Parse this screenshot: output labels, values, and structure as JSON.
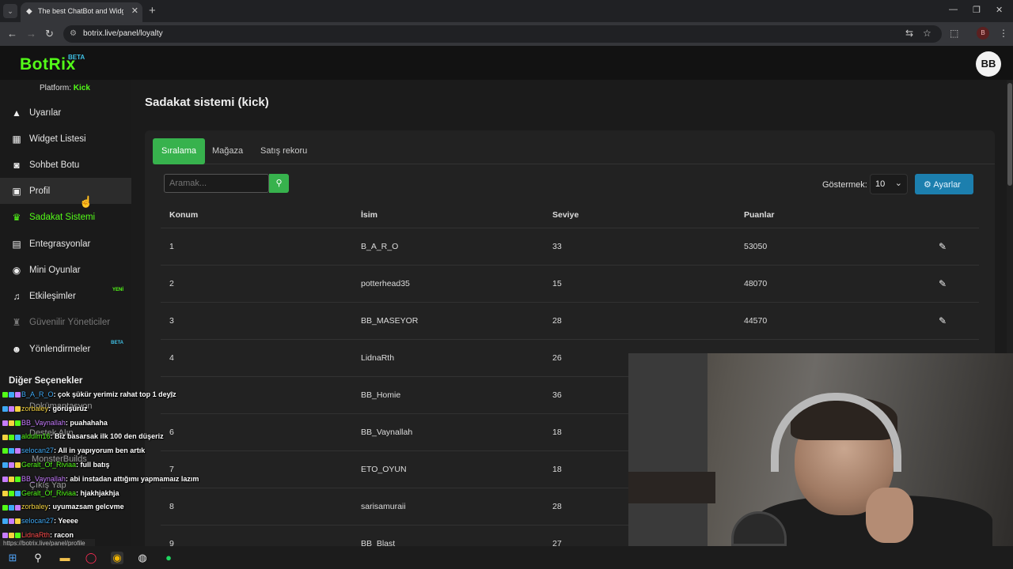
{
  "browser": {
    "tab_title": "The best ChatBot and Widgets",
    "url": "botrix.live/panel/loyalty",
    "profile_initial": "B",
    "status_url": "https://botrix.live/panel/profile"
  },
  "app": {
    "logo": "BotRix",
    "logo_badge": "BETA",
    "avatar_text": "BB",
    "platform_label": "Platform:",
    "platform_value": "Kick"
  },
  "sidebar": {
    "items": [
      {
        "label": "Uyarılar",
        "icon": "warning-icon"
      },
      {
        "label": "Widget Listesi",
        "icon": "grid-icon"
      },
      {
        "label": "Sohbet Botu",
        "icon": "robot-icon"
      },
      {
        "label": "Profil",
        "icon": "profile-card-icon"
      },
      {
        "label": "Sadakat Sistemi",
        "icon": "trophy-icon"
      },
      {
        "label": "Entegrasyonlar",
        "icon": "integration-icon"
      },
      {
        "label": "Mini Oyunlar",
        "icon": "gamepad-icon"
      },
      {
        "label": "Etkileşimler",
        "icon": "music-icon",
        "badge": "YENİ"
      },
      {
        "label": "Güvenilir Yöneticiler",
        "icon": "user-shield-icon"
      },
      {
        "label": "Yönlendirmeler",
        "icon": "users-icon",
        "badge": "BETA"
      }
    ],
    "other_heading": "Diğer Seçenekler",
    "other_items": [
      "Dokümantasyon",
      "Destek Alın",
      "MonsterBuilds",
      "Çıkış Yap"
    ]
  },
  "page": {
    "title": "Sadakat sistemi (kick)",
    "tabs": [
      "Sıralama",
      "Mağaza",
      "Satış rekoru"
    ],
    "search_placeholder": "Aramak...",
    "show_label": "Göstermek:",
    "show_value": "10",
    "settings_label": "Ayarlar",
    "columns": [
      "Konum",
      "İsim",
      "Seviye",
      "Puanlar"
    ],
    "rows": [
      {
        "pos": "1",
        "name": "B_A_R_O",
        "level": "33",
        "points": "53050"
      },
      {
        "pos": "2",
        "name": "potterhead35",
        "level": "15",
        "points": "48070"
      },
      {
        "pos": "3",
        "name": "BB_MASEYOR",
        "level": "28",
        "points": "44570"
      },
      {
        "pos": "4",
        "name": "LidnaRth",
        "level": "26",
        "points": ""
      },
      {
        "pos": "5",
        "name": "BB_Homie",
        "level": "36",
        "points": ""
      },
      {
        "pos": "6",
        "name": "BB_Vaynallah",
        "level": "18",
        "points": ""
      },
      {
        "pos": "7",
        "name": "ETO_OYUN",
        "level": "18",
        "points": ""
      },
      {
        "pos": "8",
        "name": "sarisamuraii",
        "level": "28",
        "points": ""
      },
      {
        "pos": "9",
        "name": "BB_Blast",
        "level": "27",
        "points": ""
      }
    ]
  },
  "chat": [
    {
      "user": "B_A_R_O",
      "color": "#3fa9f5",
      "msg": ": çok şükür yerimiz rahat top 1 deyiz"
    },
    {
      "user": "zorbaley",
      "color": "#f5d33f",
      "msg": ": görüşürüz"
    },
    {
      "user": "BB_Vaynallah",
      "color": "#c77dff",
      "msg": ": puahahaha"
    },
    {
      "user": "aldulm16",
      "color": "#53fc18",
      "msg": ": Biz basarsak ilk 100 den düşeriz"
    },
    {
      "user": "selocan27",
      "color": "#3fa9f5",
      "msg": ": All in yapıyorum ben artık"
    },
    {
      "user": "Geralt_Of_Riviaa",
      "color": "#53fc18",
      "msg": ": full batış"
    },
    {
      "user": "BB_Vaynallah",
      "color": "#c77dff",
      "msg": ": abi instadan attığımı yapmamaız lazım"
    },
    {
      "user": "Geralt_Of_Riviaa",
      "color": "#53fc18",
      "msg": ": hjakhjakhja"
    },
    {
      "user": "zorbaley",
      "color": "#f5d33f",
      "msg": ": uyumazsam gelcvme"
    },
    {
      "user": "selocan27",
      "color": "#3fa9f5",
      "msg": ": Yeeee"
    },
    {
      "user": "LidnaRth",
      "color": "#ff4d4d",
      "msg": ": racon"
    }
  ],
  "colors": {
    "accent": "#53fc18",
    "tab_active": "#37b24d",
    "settings": "#1c7fae"
  }
}
